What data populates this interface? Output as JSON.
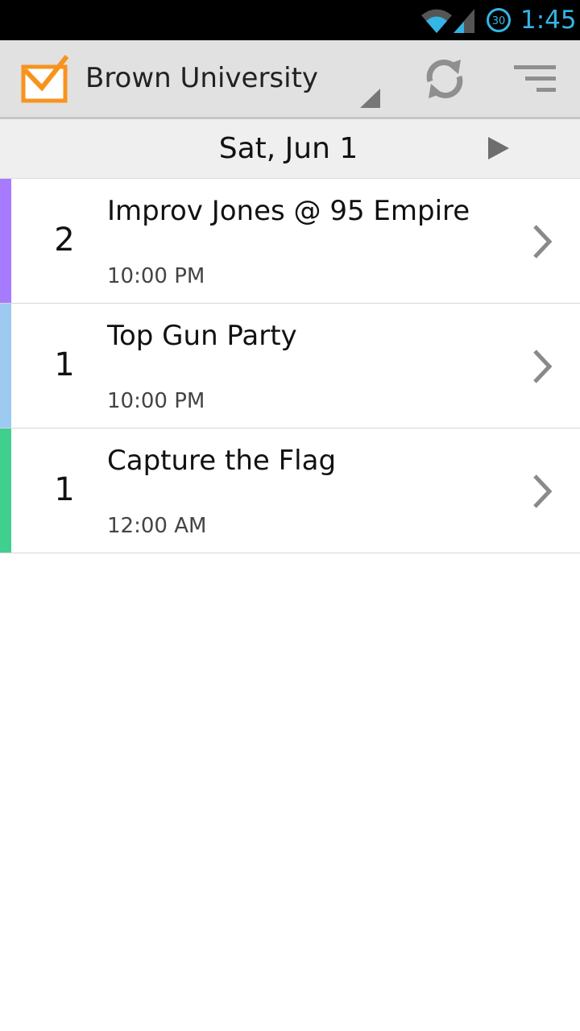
{
  "status_bar": {
    "time": "1:45",
    "battery_level": "30",
    "accent_color": "#33b5e5"
  },
  "action_bar": {
    "app_icon": "calendar-check-icon",
    "campus_name": "Brown University",
    "refresh_icon": "refresh-icon",
    "menu_icon": "sort-menu-icon",
    "brand_color": "#f7941d"
  },
  "date_header": {
    "date": "Sat, Jun 1",
    "next_icon": "play-triangle-icon"
  },
  "events": [
    {
      "count": "2",
      "title": "Improv Jones @ 95 Empire",
      "time": "10:00 PM",
      "color": "#a77bff"
    },
    {
      "count": "1",
      "title": "Top Gun Party",
      "time": "10:00 PM",
      "color": "#9ccaf0"
    },
    {
      "count": "1",
      "title": "Capture the Flag",
      "time": "12:00 AM",
      "color": "#3fcf8e"
    }
  ]
}
